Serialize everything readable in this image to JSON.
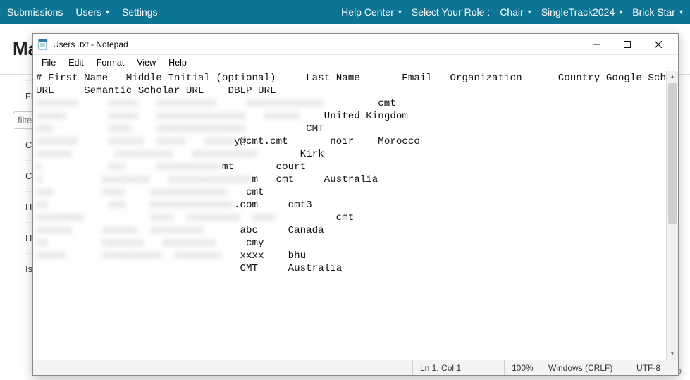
{
  "navbar": {
    "left": [
      "Submissions",
      "Users",
      "Settings"
    ],
    "left_dropdown_indices": [
      1
    ],
    "right": [
      "Help Center",
      "Select Your Role :",
      "Chair",
      "SingleTrack2024",
      "Brick Star"
    ],
    "right_dropdown_indices": [
      0,
      2,
      3,
      4
    ]
  },
  "page": {
    "title_prefix": "Ma"
  },
  "filter_input": {
    "placeholder_prefix": "filte"
  },
  "side_labels": [
    "First",
    "Ca",
    "C",
    "H",
    "Hum",
    "Is"
  ],
  "lower_right": "available",
  "notepad": {
    "title": "Users   .txt - Notepad",
    "menus": [
      "File",
      "Edit",
      "Format",
      "View",
      "Help"
    ],
    "header_line": "# First Name   Middle Initial (optional)     Last Name       Email   Organization      Country Google Scholar URL     Semantic Scholar URL    DBLP URL",
    "rows": [
      {
        "blur": "xxxxxxx     xxxxx   xxxxxxxxxx     xxxxxxxxxxxxx",
        "clear": "         cmt"
      },
      {
        "blur": "xxxxx       xxxxx   xxxxxxxxxxxxxxx   xxxxxx",
        "clear": "    United Kingdom"
      },
      {
        "blur": "xxx         xxxx    xxxxxxxxxxxxxxx",
        "clear": "          CMT"
      },
      {
        "blur": "xxxxxxx     xxxxxx  xxxxx   xxxxx",
        "clear": "y@cmt.cmt       noir    Morocco"
      },
      {
        "blur": "xxxxxx       xxxxxxxxxx   xxxxxxxxxxx",
        "clear": "       Kirk"
      },
      {
        "blur": "x           xxx     xxxxxxxxxxx",
        "clear": "mt       court"
      },
      {
        "blur": "x          xxxxxxxx   xxxxxxxxxxxxxx",
        "clear": "m   cmt     Australia"
      },
      {
        "blur": "xxx        xxxx    xxxxxxxxxxxxx",
        "clear": "   cmt"
      },
      {
        "blur": "xx          xxx    xxxxxxxxxxxxxx",
        "clear": ".com     cmt3"
      },
      {
        "blur": "xxxxxxxx           xxxx  xxxxxxxxx  xxxx",
        "clear": "          cmt"
      },
      {
        "blur": "xxxxxx     xxxxxx  xxxxxxxxx",
        "clear": "      abc     Canada"
      },
      {
        "blur": "xx         xxxxxxx   xxxxxxxxx",
        "clear": "     cmy"
      },
      {
        "blur": "xxxxx      xxxxxxxxxx  xxxxxxxx   ",
        "clear": "xxxx    bhu"
      },
      {
        "blur": "                              ",
        "clear": "    CMT     Australia"
      }
    ],
    "status": {
      "position": "Ln 1, Col 1",
      "zoom": "100%",
      "eol": "Windows (CRLF)",
      "encoding": "UTF-8"
    }
  }
}
